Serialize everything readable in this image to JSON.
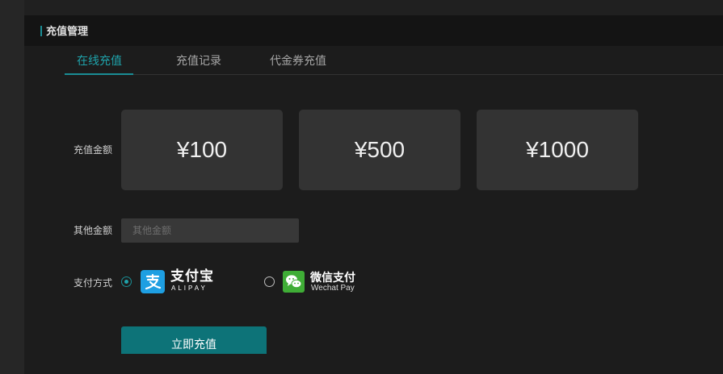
{
  "header": {
    "title": "充值管理"
  },
  "tabs": [
    {
      "label": "在线充值",
      "active": true
    },
    {
      "label": "充值记录",
      "active": false
    },
    {
      "label": "代金券充值",
      "active": false
    }
  ],
  "amount": {
    "label": "充值金额",
    "options": [
      "¥100",
      "¥500",
      "¥1000"
    ]
  },
  "other_amount": {
    "label": "其他金额",
    "placeholder": "其他金额",
    "value": ""
  },
  "payment": {
    "label": "支付方式",
    "methods": [
      {
        "name": "支付宝",
        "sub": "ALIPAY",
        "selected": true,
        "icon": "alipay-icon",
        "color": "#1e9fe2"
      },
      {
        "name": "微信支付",
        "sub": "Wechat Pay",
        "selected": false,
        "icon": "wechat-icon",
        "color": "#3fad36"
      }
    ]
  },
  "submit": {
    "label": "立即充值"
  },
  "colors": {
    "accent": "#1a8e95",
    "button": "#0d7378",
    "card": "#333333"
  }
}
